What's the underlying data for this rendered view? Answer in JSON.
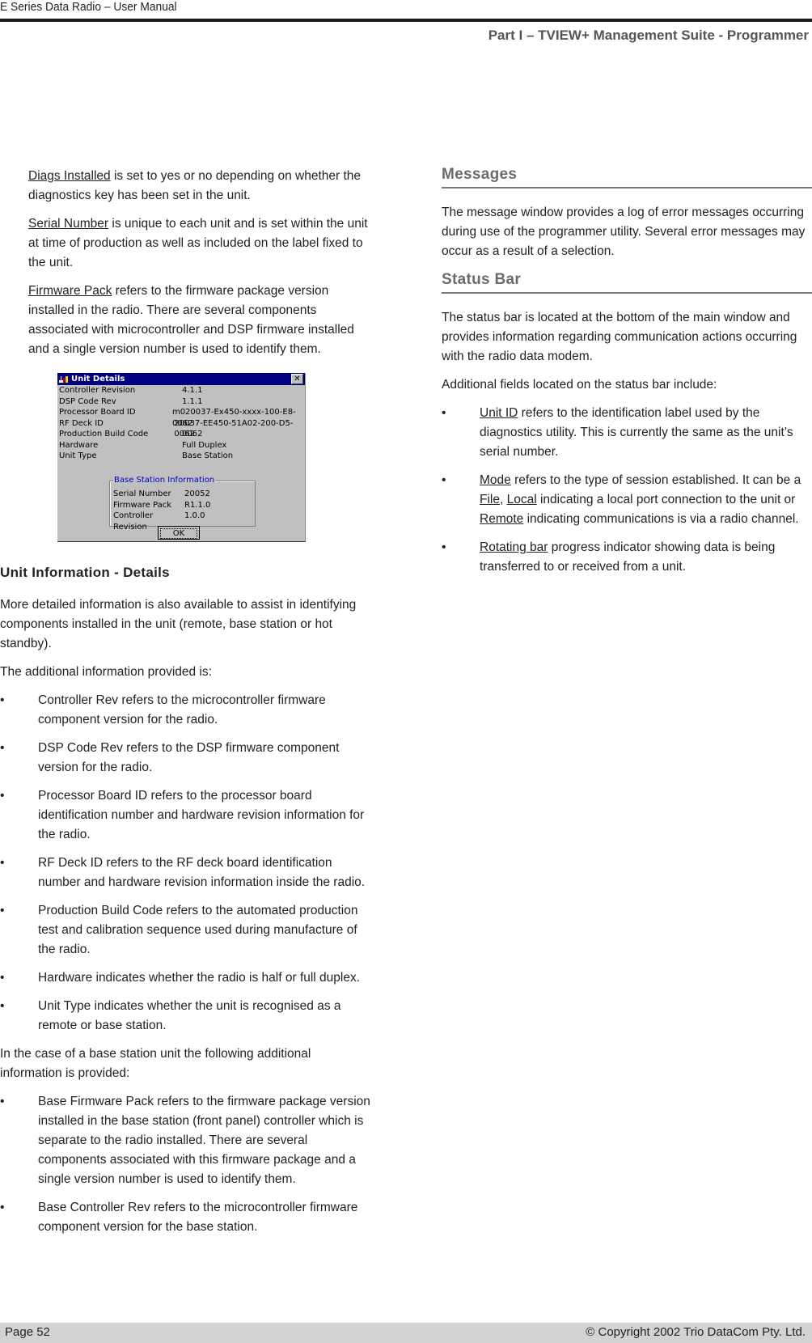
{
  "header": {
    "running_title": "E Series Data Radio – User Manual",
    "part_title": "Part I – TVIEW+ Management Suite - Programmer"
  },
  "left_column": {
    "defs": [
      {
        "term": "Diags Installed",
        "text": " is set to yes or no depending on whether the diagnostics key has been set in the unit."
      },
      {
        "term": "Serial Number",
        "text": " is unique to each unit and is set within the unit at time of production as well as included on the label fixed to the unit."
      },
      {
        "term": "Firmware Pack",
        "text": " refers to the firmware package version installed in the radio. There are several components associated with microcontroller and DSP firmware installed and a single version number is used to identify them."
      }
    ],
    "dialog": {
      "title": "Unit Details",
      "close_glyph": "✕",
      "rows": [
        {
          "label": "Controller Revision",
          "value": "4.1.1"
        },
        {
          "label": "DSP Code Rev",
          "value": "1.1.1"
        },
        {
          "label": "Processor Board ID",
          "value": " m020037-Ex450-xxxx-100-E8-0062"
        },
        {
          "label": "RF Deck ID",
          "value": "20037-EE450-51A02-200-D5-0062"
        },
        {
          "label": "Production Build Code",
          "value": "0062"
        },
        {
          "label": "Hardware",
          "value": "Full Duplex"
        },
        {
          "label": "Unit Type",
          "value": "Base Station"
        }
      ],
      "group_title": "Base Station Information",
      "group_rows": [
        {
          "label": "Serial Number",
          "value": "20052"
        },
        {
          "label": "Firmware Pack",
          "value": "R1.1.0"
        },
        {
          "label": "Controller Revision",
          "value": "1.0.0"
        }
      ],
      "ok_label": "OK"
    },
    "heading": "Unit Information - Details",
    "intro": "More detailed information is also available to assist in identifying components installed in the unit (remote, base station or hot standby).",
    "lead": "The additional information provided is:",
    "bullets": [
      "Controller Rev refers to the microcontroller firmware component version for the radio.",
      "DSP Code Rev refers to the DSP firmware component version for the radio.",
      "Processor Board ID refers to the processor board identification number and hardware revision information for the radio.",
      "RF Deck ID refers to the RF deck board identification number and hardware revision information inside the radio.",
      "Production Build Code refers to the automated production test and calibration sequence used during manufacture of the radio.",
      "Hardware indicates whether the radio is half or full duplex.",
      "Unit Type indicates whether the unit is recognised as a remote or base station."
    ],
    "base_lead": "In the case of a base station unit the following additional information is provided:",
    "base_bullets": [
      "Base Firmware Pack refers to the firmware package version installed in the base station (front panel) controller which is separate to the radio installed. There are several components associated with this firmware package and a single version number is used to identify them.",
      "Base Controller Rev refers to the microcontroller firmware component version for the base station."
    ]
  },
  "right_column": {
    "messages_heading": "Messages",
    "messages_text": "The message window provides a log of error messages occurring during use of the programmer utility. Several error messages may occur as a result of a selection.",
    "status_heading": "Status Bar",
    "status_text": "The status bar is located at the bottom of the main window and provides information regarding communication actions occurring with the radio data modem.",
    "fields_lead": "Additional fields located on the status bar include:",
    "field_bullets": {
      "unit_id": {
        "term": "Unit ID",
        "text": " refers to the identification label used by the diagnostics utility. This is currently the same as the unit’s serial number."
      },
      "mode": {
        "term": "Mode",
        "text1": " refers to the type of session established. It can be a ",
        "file": "File",
        "sep": ", ",
        "local": "Local",
        "text2": " indicating a local port connection to the unit or ",
        "remote": "Remote",
        "text3": " indicating communications is via a radio channel."
      },
      "rotating": {
        "term": "Rotating bar",
        "text": " progress indicator showing data is being transferred to or received from a unit."
      }
    },
    "bullet_glyph": "•"
  },
  "footer": {
    "page": "Page 52",
    "copyright": "© Copyright 2002 Trio DataCom Pty. Ltd."
  }
}
